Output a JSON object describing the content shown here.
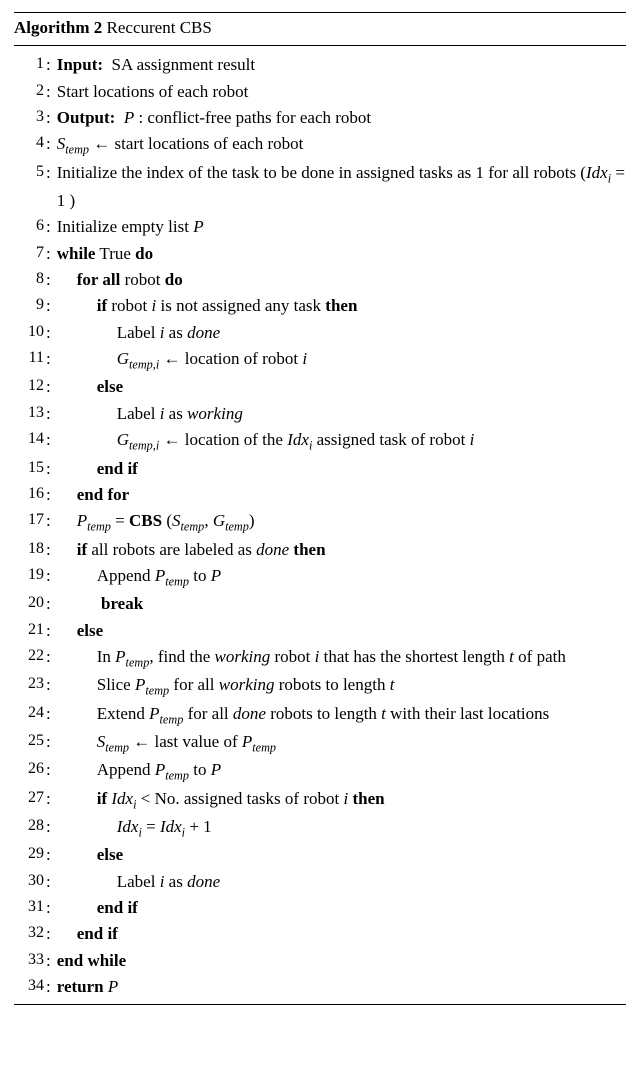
{
  "algorithm": {
    "number": "Algorithm 2",
    "title": "Reccurent CBS",
    "lines": [
      {
        "no": "1",
        "html": "<b>Input:</b>&nbsp; SA assignment result",
        "ind": 0
      },
      {
        "no": "2",
        "html": "Start locations of each robot",
        "ind": 0
      },
      {
        "no": "3",
        "html": "<b>Output:</b>&nbsp; <span class='mathit'>P</span> : conflict-free paths for each robot",
        "ind": 0
      },
      {
        "no": "4",
        "html": "<span class='mathit'>S<sub>temp</sub></span> ← start locations of each robot",
        "ind": 0
      },
      {
        "no": "5",
        "html": "Initialize the index of the task to be done in assigned tasks as 1 for all robots (<span class='mathit'>Idx<sub>i</sub></span> = 1 )",
        "ind": 0,
        "wrap": true
      },
      {
        "no": "6",
        "html": "Initialize empty list <span class='mathit'>P</span>",
        "ind": 0
      },
      {
        "no": "7",
        "html": "<b>while</b> True <b>do</b>",
        "ind": 0
      },
      {
        "no": "8",
        "html": "<b>for all</b> robot <b>do</b>",
        "ind": 1
      },
      {
        "no": "9",
        "html": "<b>if</b> robot <span class='mathit'>i</span> is not assigned any task <b>then</b>",
        "ind": 2
      },
      {
        "no": "10",
        "html": "Label <span class='mathit'>i</span> as <i>done</i>",
        "ind": 3
      },
      {
        "no": "11",
        "html": "<span class='mathit'>G<sub>temp,i</sub></span> ← location of robot <span class='mathit'>i</span>",
        "ind": 3
      },
      {
        "no": "12",
        "html": "<b>else</b>",
        "ind": 2
      },
      {
        "no": "13",
        "html": "Label <span class='mathit'>i</span> as <i>working</i>",
        "ind": 3
      },
      {
        "no": "14",
        "html": "<span class='mathit'>G<sub>temp,i</sub></span> ← location of the <span class='mathit'>Idx<sub>i</sub></span> assigned task of robot <span class='mathit'>i</span>",
        "ind": 3,
        "wrap": true
      },
      {
        "no": "15",
        "html": "<b>end if</b>",
        "ind": 2
      },
      {
        "no": "16",
        "html": "<b>end for</b>",
        "ind": 1
      },
      {
        "no": "17",
        "html": "<span class='mathit'>P<sub>temp</sub></span> = <b>CBS</b> (<span class='mathit'>S<sub>temp</sub></span>, <span class='mathit'>G<sub>temp</sub></span>)",
        "ind": 1
      },
      {
        "no": "18",
        "html": "<b>if</b> all robots are labeled as <i>done</i> <b>then</b>",
        "ind": 1
      },
      {
        "no": "19",
        "html": "Append <span class='mathit'>P<sub>temp</sub></span> to <span class='mathit'>P</span>",
        "ind": 2
      },
      {
        "no": "20",
        "html": "&nbsp;<b>break</b>",
        "ind": 2
      },
      {
        "no": "21",
        "html": "<b>else</b>",
        "ind": 1
      },
      {
        "no": "22",
        "html": "In <span class='mathit'>P<sub>temp</sub></span>, find the <i>working</i> robot <span class='mathit'>i</span> that has the shortest length <span class='mathit'>t</span> of path",
        "ind": 2,
        "wrap": true
      },
      {
        "no": "23",
        "html": "Slice <span class='mathit'>P<sub>temp</sub></span> for all <i>working</i> robots to length <span class='mathit'>t</span>",
        "ind": 2
      },
      {
        "no": "24",
        "html": "Extend <span class='mathit'>P<sub>temp</sub></span> for all <i>done</i> robots to length <span class='mathit'>t</span> with their last locations",
        "ind": 2,
        "wrap": true
      },
      {
        "no": "25",
        "html": "<span class='mathit'>S<sub>temp</sub></span> ← last value of <span class='mathit'>P<sub>temp</sub></span>",
        "ind": 2
      },
      {
        "no": "26",
        "html": "Append <span class='mathit'>P<sub>temp</sub></span> to <span class='mathit'>P</span>",
        "ind": 2
      },
      {
        "no": "27",
        "html": "<b>if</b> <span class='mathit'>Idx<sub>i</sub></span> &lt; No. assigned tasks of robot <span class='mathit'>i</span> <b>then</b>",
        "ind": 2
      },
      {
        "no": "28",
        "html": "<span class='mathit'>Idx<sub>i</sub></span> = <span class='mathit'>Idx<sub>i</sub></span> + 1",
        "ind": 3
      },
      {
        "no": "29",
        "html": "<b>else</b>",
        "ind": 2
      },
      {
        "no": "30",
        "html": "Label <span class='mathit'>i</span> as <i>done</i>",
        "ind": 3
      },
      {
        "no": "31",
        "html": "<b>end if</b>",
        "ind": 2
      },
      {
        "no": "32",
        "html": "<b>end if</b>",
        "ind": 1
      },
      {
        "no": "33",
        "html": "<b>end while</b>",
        "ind": 0
      },
      {
        "no": "34",
        "html": "<b>return</b> <span class='mathit'>P</span>",
        "ind": 0
      }
    ]
  }
}
